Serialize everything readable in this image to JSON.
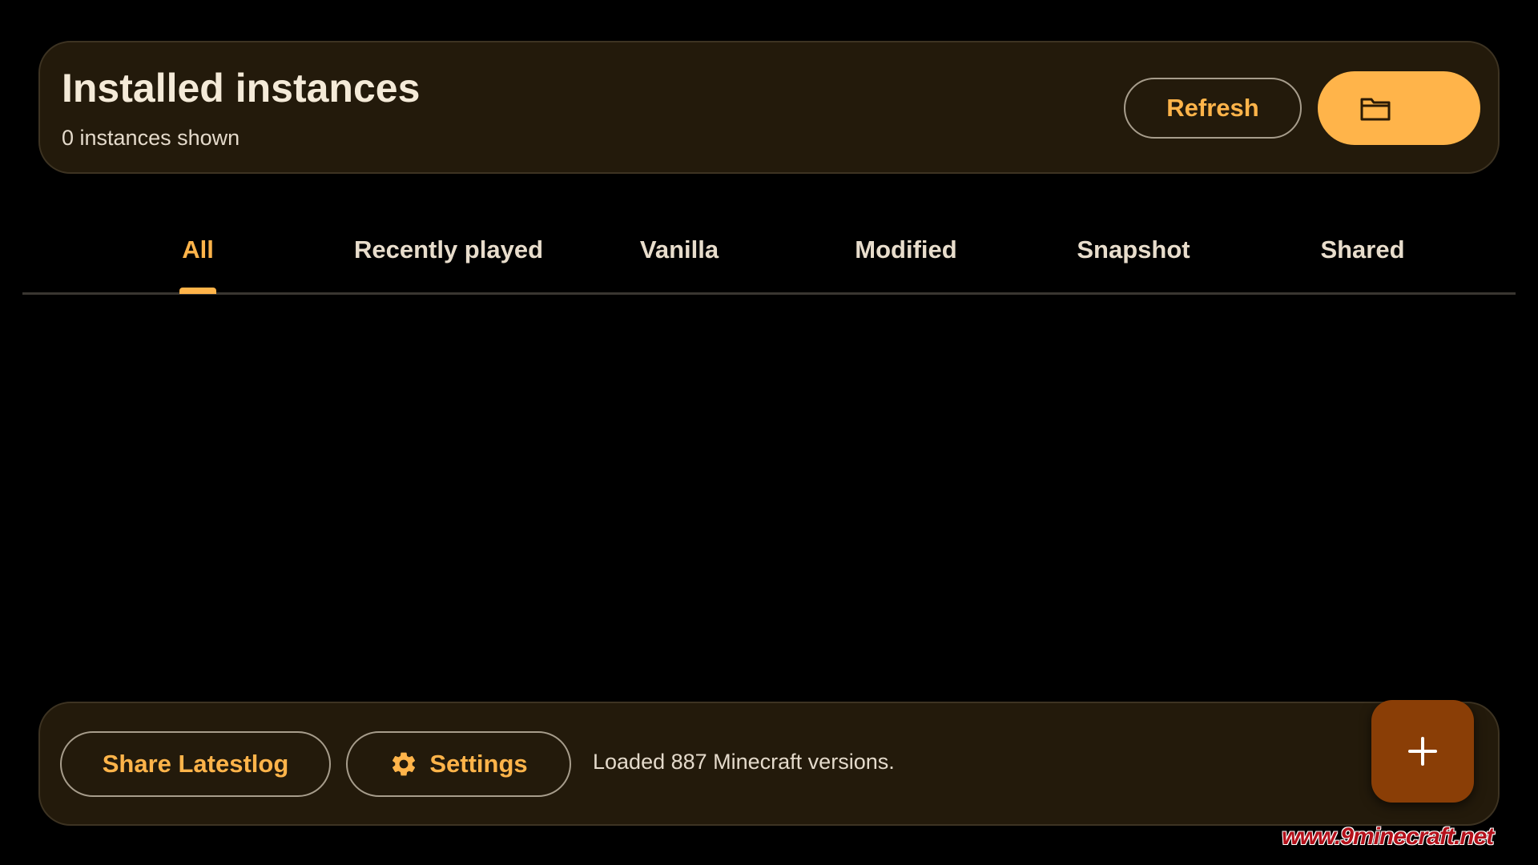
{
  "header": {
    "title": "Installed instances",
    "subtitle": "0 instances shown",
    "refresh_label": "Refresh",
    "folder_icon": "folder-icon"
  },
  "tabs": [
    {
      "label": "All",
      "active": true
    },
    {
      "label": "Recently played",
      "active": false
    },
    {
      "label": "Vanilla",
      "active": false
    },
    {
      "label": "Modified",
      "active": false
    },
    {
      "label": "Snapshot",
      "active": false
    },
    {
      "label": "Shared",
      "active": false
    }
  ],
  "footer": {
    "share_label": "Share Latestlog",
    "settings_label": "Settings",
    "settings_icon": "gear-icon",
    "status": "Loaded 887 Minecraft versions."
  },
  "fab": {
    "icon": "plus-icon"
  },
  "watermark": "www.9minecraft.net",
  "colors": {
    "accent": "#ffb44a",
    "card_bg": "#231a0b",
    "fab_bg": "#8a3e06",
    "background": "#000000"
  }
}
